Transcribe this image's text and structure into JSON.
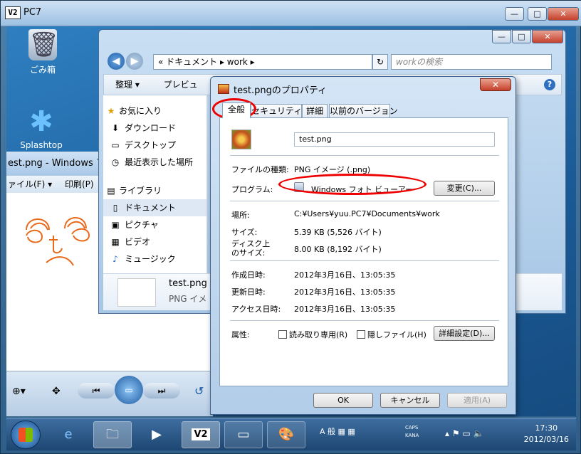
{
  "vnc": {
    "title": "PC7",
    "logo": "V2"
  },
  "desktop": {
    "icons": [
      {
        "label": "ごみ箱",
        "icon": "recycle-bin-icon"
      },
      {
        "label": "Splashtop",
        "icon": "splashtop-icon"
      }
    ]
  },
  "viewer": {
    "title": "est.png - Windows フォ",
    "menu": [
      "ァイル(F) ▾",
      "印刷(P)"
    ]
  },
  "explorer": {
    "address": "«  ドキュメント  ▸  work  ▸",
    "search_placeholder": "workの検索",
    "toolbar": [
      "整理 ▾",
      "プレビュ"
    ],
    "nav": [
      {
        "label": "お気に入り",
        "icon": "★",
        "group": true
      },
      {
        "label": "ダウンロード",
        "icon": "⬇"
      },
      {
        "label": "デスクトップ",
        "icon": "▭"
      },
      {
        "label": "最近表示した場所",
        "icon": "◷"
      },
      {
        "label": "ライブラリ",
        "icon": "▤",
        "group": true
      },
      {
        "label": "ドキュメント",
        "icon": "▯",
        "selected": true
      },
      {
        "label": "ピクチャ",
        "icon": "▣"
      },
      {
        "label": "ビデオ",
        "icon": "▦"
      },
      {
        "label": "ミュージック",
        "icon": "♪"
      }
    ],
    "details": {
      "name": "test.png",
      "type": "PNG イメ"
    }
  },
  "dialog": {
    "title": "test.pngのプロパティ",
    "close": "✕",
    "tabs": [
      "全般",
      "セキュリティ",
      "詳細",
      "以前のバージョン"
    ],
    "filename": "test.png",
    "rows": {
      "type_label": "ファイルの種類:",
      "type_value": "PNG イメージ (.png)",
      "program_label": "プログラム:",
      "program_value": "Windows フォト ビューアー",
      "change_button": "変更(C)...",
      "location_label": "場所:",
      "location_value": "C:¥Users¥yuu.PC7¥Documents¥work",
      "size_label": "サイズ:",
      "size_value": "5.39 KB (5,526 バイト)",
      "disk_label_1": "ディスク上",
      "disk_label_2": "のサイズ:",
      "disk_value": "8.00 KB (8,192 バイト)",
      "created_label": "作成日時:",
      "created_value": "2012年3月16日、13:05:35",
      "modified_label": "更新日時:",
      "modified_value": "2012年3月16日、13:05:35",
      "accessed_label": "アクセス日時:",
      "accessed_value": "2012年3月16日、13:05:35",
      "attr_label": "属性:",
      "readonly": "読み取り専用(R)",
      "hidden": "隠しファイル(H)",
      "advanced_button": "詳細設定(D)..."
    },
    "buttons": {
      "ok": "OK",
      "cancel": "キャンセル",
      "apply": "適用(A)"
    }
  },
  "taskbar": {
    "ime": "A 般",
    "caps": "CAPS",
    "kana": "KANA",
    "time": "17:30",
    "date": "2012/03/16"
  }
}
